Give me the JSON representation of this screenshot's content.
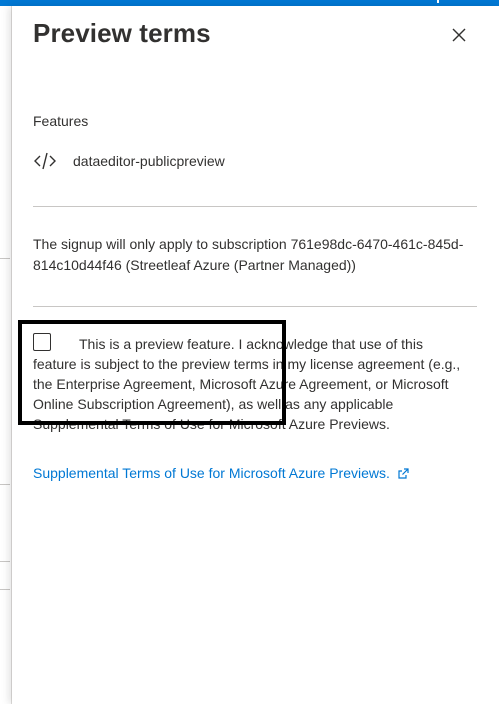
{
  "panel": {
    "title": "Preview terms",
    "close_icon": "close-icon"
  },
  "features": {
    "label": "Features",
    "items": [
      {
        "icon": "code-icon",
        "name": "dataeditor-publicpreview"
      }
    ]
  },
  "signup_notice": "The signup will only apply to subscription 761e98dc-6470-461c-845d-814c10d44f46 (Streetleaf Azure (Partner Managed))",
  "acknowledgement": {
    "checked": false,
    "text": "This is a preview feature. I acknowledge that use of this feature is subject to the preview terms in my license agreement (e.g., the Enterprise Agreement, Microsoft Azure Agreement, or Microsoft Online Subscription Agreement), as well as any applicable Supplemental Terms of Use for Microsoft Azure Previews."
  },
  "link": {
    "text": "Supplemental Terms of Use for Microsoft Azure Previews.",
    "icon": "external-link-icon"
  },
  "colors": {
    "accent": "#0078d4",
    "text": "#323130",
    "divider": "#c8c6c4"
  }
}
